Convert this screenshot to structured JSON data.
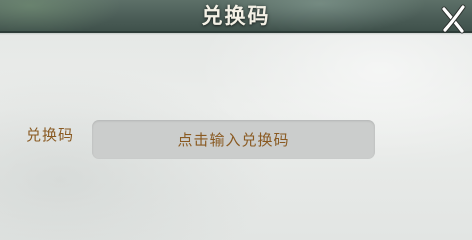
{
  "dialog": {
    "title": "兑换码",
    "close_icon": "close-x-icon"
  },
  "form": {
    "label": "兑换码",
    "input_placeholder": "点击输入兑换码"
  },
  "colors": {
    "title_bar": "#4a5c56",
    "title_text": "#f4f1e6",
    "label_text": "#8a5a22",
    "input_bg": "#cbcdcc",
    "panel_bg": "#e6e8e6"
  }
}
